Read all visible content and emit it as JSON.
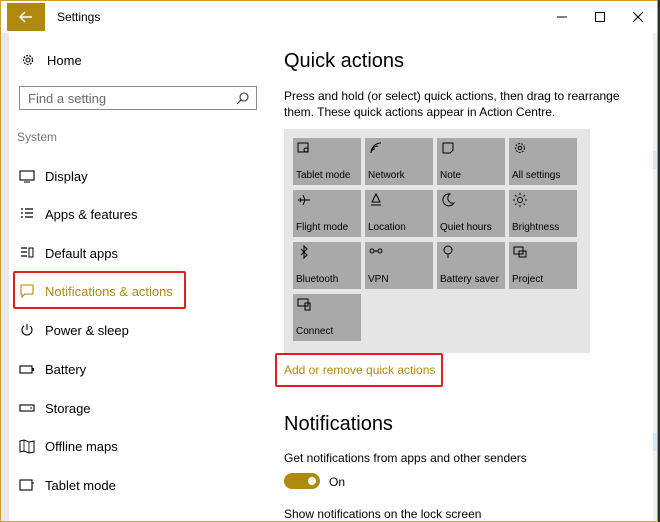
{
  "window": {
    "title": "Settings"
  },
  "sidebar": {
    "home_label": "Home",
    "search_placeholder": "Find a setting",
    "section_label": "System",
    "items": [
      {
        "label": "Display",
        "icon": "monitor-icon"
      },
      {
        "label": "Apps & features",
        "icon": "list-icon"
      },
      {
        "label": "Default apps",
        "icon": "default-apps-icon"
      },
      {
        "label": "Notifications & actions",
        "icon": "notification-icon",
        "selected": true
      },
      {
        "label": "Power & sleep",
        "icon": "power-icon"
      },
      {
        "label": "Battery",
        "icon": "battery-icon"
      },
      {
        "label": "Storage",
        "icon": "storage-icon"
      },
      {
        "label": "Offline maps",
        "icon": "map-icon"
      },
      {
        "label": "Tablet mode",
        "icon": "tablet-icon"
      }
    ]
  },
  "main": {
    "quick_actions_title": "Quick actions",
    "quick_actions_desc": "Press and hold (or select) quick actions, then drag to rearrange them. These quick actions appear in Action Centre.",
    "tiles": [
      {
        "label": "Tablet mode",
        "icon": "tablet-mode-icon"
      },
      {
        "label": "Network",
        "icon": "network-icon"
      },
      {
        "label": "Note",
        "icon": "note-icon"
      },
      {
        "label": "All settings",
        "icon": "gear-icon"
      },
      {
        "label": "Flight mode",
        "icon": "airplane-icon"
      },
      {
        "label": "Location",
        "icon": "location-icon"
      },
      {
        "label": "Quiet hours",
        "icon": "moon-icon"
      },
      {
        "label": "Brightness",
        "icon": "sun-icon"
      },
      {
        "label": "Bluetooth",
        "icon": "bluetooth-icon"
      },
      {
        "label": "VPN",
        "icon": "vpn-icon"
      },
      {
        "label": "Battery saver",
        "icon": "battery-saver-icon"
      },
      {
        "label": "Project",
        "icon": "project-icon"
      },
      {
        "label": "Connect",
        "icon": "connect-icon"
      }
    ],
    "add_remove_link": "Add or remove quick actions",
    "notifications_title": "Notifications",
    "notifications_desc": "Get notifications from apps and other senders",
    "toggle_state": "On",
    "cut_text": "Show notifications on the lock screen"
  },
  "colors": {
    "accent": "#b08a0f",
    "highlight_box": "#e02020",
    "tile_bg": "#a9a9a9",
    "panel_bg": "#e6e6e6"
  }
}
